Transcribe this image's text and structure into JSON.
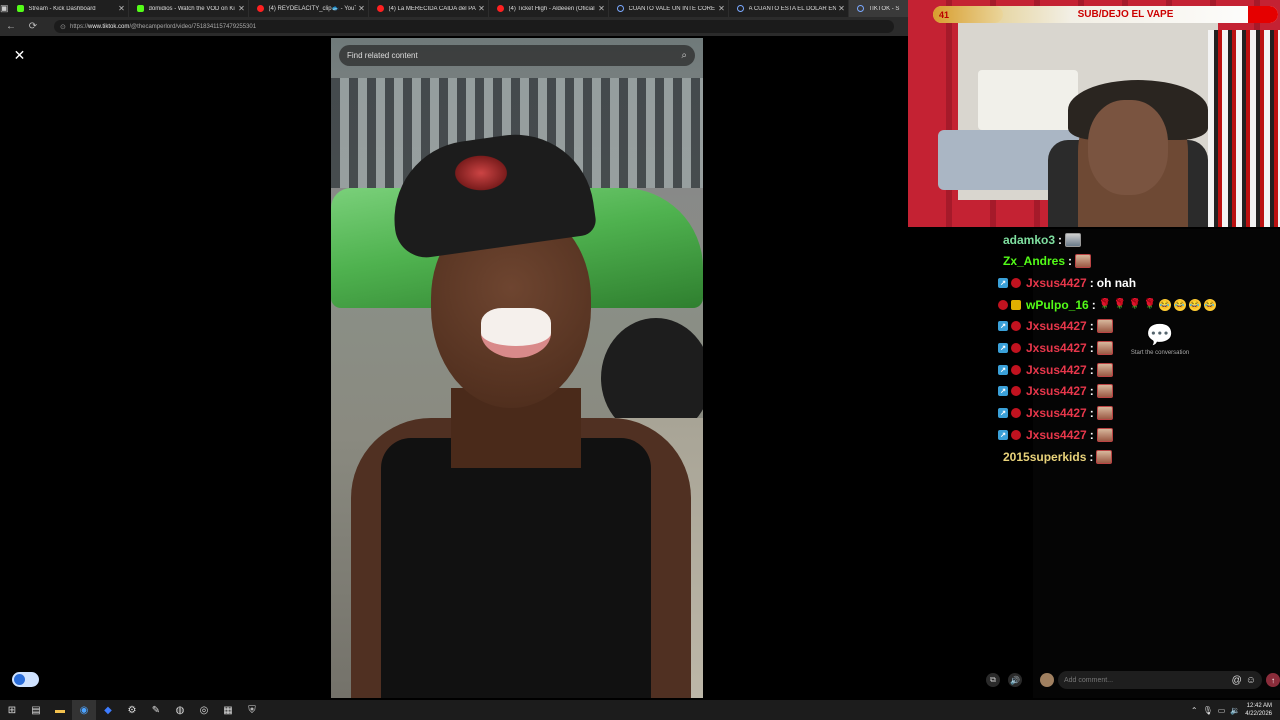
{
  "browser": {
    "tabs": [
      {
        "label": "Stream - Kick Dashboard",
        "favicon": "kick-icon",
        "active": false
      },
      {
        "label": "domidios - Watch the VOD on Ki",
        "favicon": "kick-icon",
        "active": false
      },
      {
        "label": "(4) REYDELACITY_clip🐟 - YouTu",
        "favicon": "youtube-icon",
        "active": false
      },
      {
        "label": "(4) La MERECIDA CAÍDA del PADR",
        "favicon": "youtube-icon",
        "active": false
      },
      {
        "label": "(4) Ticket High - Aldeeen (Oficial",
        "favicon": "youtube-icon",
        "active": false
      },
      {
        "label": "CUANTO VALE UN INTE CORE 7 -",
        "favicon": "search-icon",
        "active": false
      },
      {
        "label": "A CUANTO ESTA EL DOLAR EN VE",
        "favicon": "search-icon",
        "active": false
      },
      {
        "label": "TIKTOK - S",
        "favicon": "search-icon",
        "active": true
      }
    ],
    "url_prefix": "https://",
    "url_host": "www.tiktok.com",
    "url_path": "/@thecamperlord/video/7518341157479255301"
  },
  "tiktok": {
    "search_placeholder": "Find related content",
    "start_conversation": "Start the conversation",
    "comment_placeholder": "Add comment..."
  },
  "stream_overlay": {
    "count": "41",
    "title": "SUB/DEJO EL VAPE",
    "accent": "#c00000"
  },
  "chat": [
    {
      "user": "adamko3",
      "color": "#7fe0a0",
      "badges": [],
      "message": "",
      "emotes": [
        "photo"
      ]
    },
    {
      "user": "Zx_Andres",
      "color": "#53fc18",
      "badges": [],
      "message": "",
      "emotes": [
        "face"
      ]
    },
    {
      "user": "Jxsus4427",
      "color": "#e8374b",
      "badges": [
        "verify",
        "mod"
      ],
      "message": "oh nah",
      "emotes": []
    },
    {
      "user": "wPulpo_16",
      "color": "#53fc18",
      "badges": [
        "mod",
        "gift"
      ],
      "message": "",
      "emotes": [
        "rose",
        "rose",
        "rose",
        "rose",
        "smile",
        "smile",
        "smile",
        "smile"
      ]
    },
    {
      "user": "Jxsus4427",
      "color": "#e8374b",
      "badges": [
        "verify",
        "mod"
      ],
      "message": "",
      "emotes": [
        "face"
      ]
    },
    {
      "user": "Jxsus4427",
      "color": "#e8374b",
      "badges": [
        "verify",
        "mod"
      ],
      "message": "",
      "emotes": [
        "face"
      ]
    },
    {
      "user": "Jxsus4427",
      "color": "#e8374b",
      "badges": [
        "verify",
        "mod"
      ],
      "message": "",
      "emotes": [
        "face"
      ]
    },
    {
      "user": "Jxsus4427",
      "color": "#e8374b",
      "badges": [
        "verify",
        "mod"
      ],
      "message": "",
      "emotes": [
        "face"
      ]
    },
    {
      "user": "Jxsus4427",
      "color": "#e8374b",
      "badges": [
        "verify",
        "mod"
      ],
      "message": "",
      "emotes": [
        "face"
      ]
    },
    {
      "user": "Jxsus4427",
      "color": "#e8374b",
      "badges": [
        "verify",
        "mod"
      ],
      "message": "",
      "emotes": [
        "face"
      ]
    },
    {
      "user": "2015superkids",
      "color": "#e8d27a",
      "badges": [],
      "message": "",
      "emotes": [
        "face"
      ]
    }
  ],
  "taskbar": {
    "time": "12:42 AM",
    "date": "4/22/2026",
    "apps": [
      "windows-start-icon",
      "terminal-icon",
      "folder-icon",
      "chrome-icon",
      "app-icon",
      "steam-icon",
      "pen-icon",
      "browser-icon",
      "obs-icon",
      "calendar-icon",
      "shield-icon"
    ]
  }
}
